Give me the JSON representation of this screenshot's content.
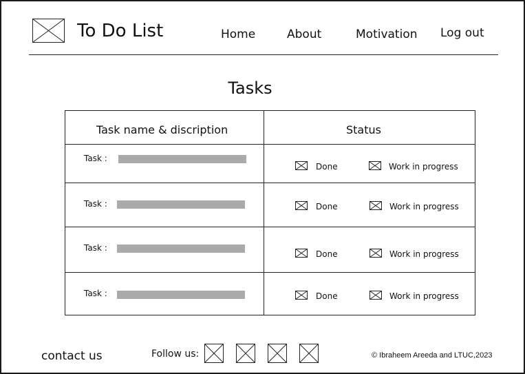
{
  "header": {
    "app_title": "To Do List",
    "logo_icon": "image-placeholder-icon",
    "nav": {
      "home": "Home",
      "about": "About",
      "motivation": "Motivation",
      "logout": "Log out"
    }
  },
  "main": {
    "title": "Tasks",
    "table": {
      "headers": [
        "Task name & discription",
        "Status"
      ],
      "rows": [
        {
          "label": "Task :",
          "done_label": "Done",
          "progress_label": "Work in progress"
        },
        {
          "label": "Task :",
          "done_label": "Done",
          "progress_label": "Work in progress"
        },
        {
          "label": "Task :",
          "done_label": "Done",
          "progress_label": "Work in progress"
        },
        {
          "label": "Task :",
          "done_label": "Done",
          "progress_label": "Work in progress"
        }
      ]
    }
  },
  "footer": {
    "contact": "contact us",
    "follow": "Follow us:",
    "social_icons": [
      "image-placeholder-icon",
      "image-placeholder-icon",
      "image-placeholder-icon",
      "image-placeholder-icon"
    ],
    "copyright": "© Ibraheem Areeda and LTUC,2023"
  },
  "colors": {
    "border": "#222222",
    "placeholder_bar": "#aaaaaa",
    "background": "#ffffff"
  }
}
